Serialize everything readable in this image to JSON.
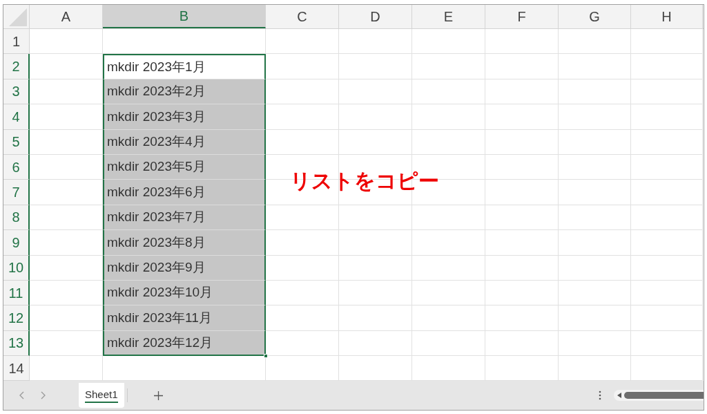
{
  "columns": [
    {
      "label": "A",
      "selected": false
    },
    {
      "label": "B",
      "selected": true
    },
    {
      "label": "C",
      "selected": false
    },
    {
      "label": "D",
      "selected": false
    },
    {
      "label": "E",
      "selected": false
    },
    {
      "label": "F",
      "selected": false
    },
    {
      "label": "G",
      "selected": false
    },
    {
      "label": "H",
      "selected": false
    }
  ],
  "rows": [
    {
      "label": "1",
      "selected": false
    },
    {
      "label": "2",
      "selected": true,
      "cell_b": {
        "text": "mkdir 2023年1月",
        "active": true
      }
    },
    {
      "label": "3",
      "selected": true,
      "cell_b": {
        "text": "mkdir 2023年2月",
        "active": false
      }
    },
    {
      "label": "4",
      "selected": true,
      "cell_b": {
        "text": "mkdir 2023年3月",
        "active": false
      }
    },
    {
      "label": "5",
      "selected": true,
      "cell_b": {
        "text": "mkdir 2023年4月",
        "active": false
      }
    },
    {
      "label": "6",
      "selected": true,
      "cell_b": {
        "text": "mkdir 2023年5月",
        "active": false
      }
    },
    {
      "label": "7",
      "selected": true,
      "cell_b": {
        "text": "mkdir 2023年6月",
        "active": false
      }
    },
    {
      "label": "8",
      "selected": true,
      "cell_b": {
        "text": "mkdir 2023年7月",
        "active": false
      }
    },
    {
      "label": "9",
      "selected": true,
      "cell_b": {
        "text": "mkdir 2023年8月",
        "active": false
      }
    },
    {
      "label": "10",
      "selected": true,
      "cell_b": {
        "text": "mkdir 2023年9月",
        "active": false
      }
    },
    {
      "label": "11",
      "selected": true,
      "cell_b": {
        "text": "mkdir 2023年10月",
        "active": false
      }
    },
    {
      "label": "12",
      "selected": true,
      "cell_b": {
        "text": "mkdir 2023年11月",
        "active": false
      }
    },
    {
      "label": "13",
      "selected": true,
      "cell_b": {
        "text": "mkdir 2023年12月",
        "active": false
      }
    },
    {
      "label": "14",
      "selected": false
    }
  ],
  "annotation": "リストをコピー",
  "sheet_tabs": [
    {
      "label": "Sheet1",
      "selected": true
    }
  ]
}
